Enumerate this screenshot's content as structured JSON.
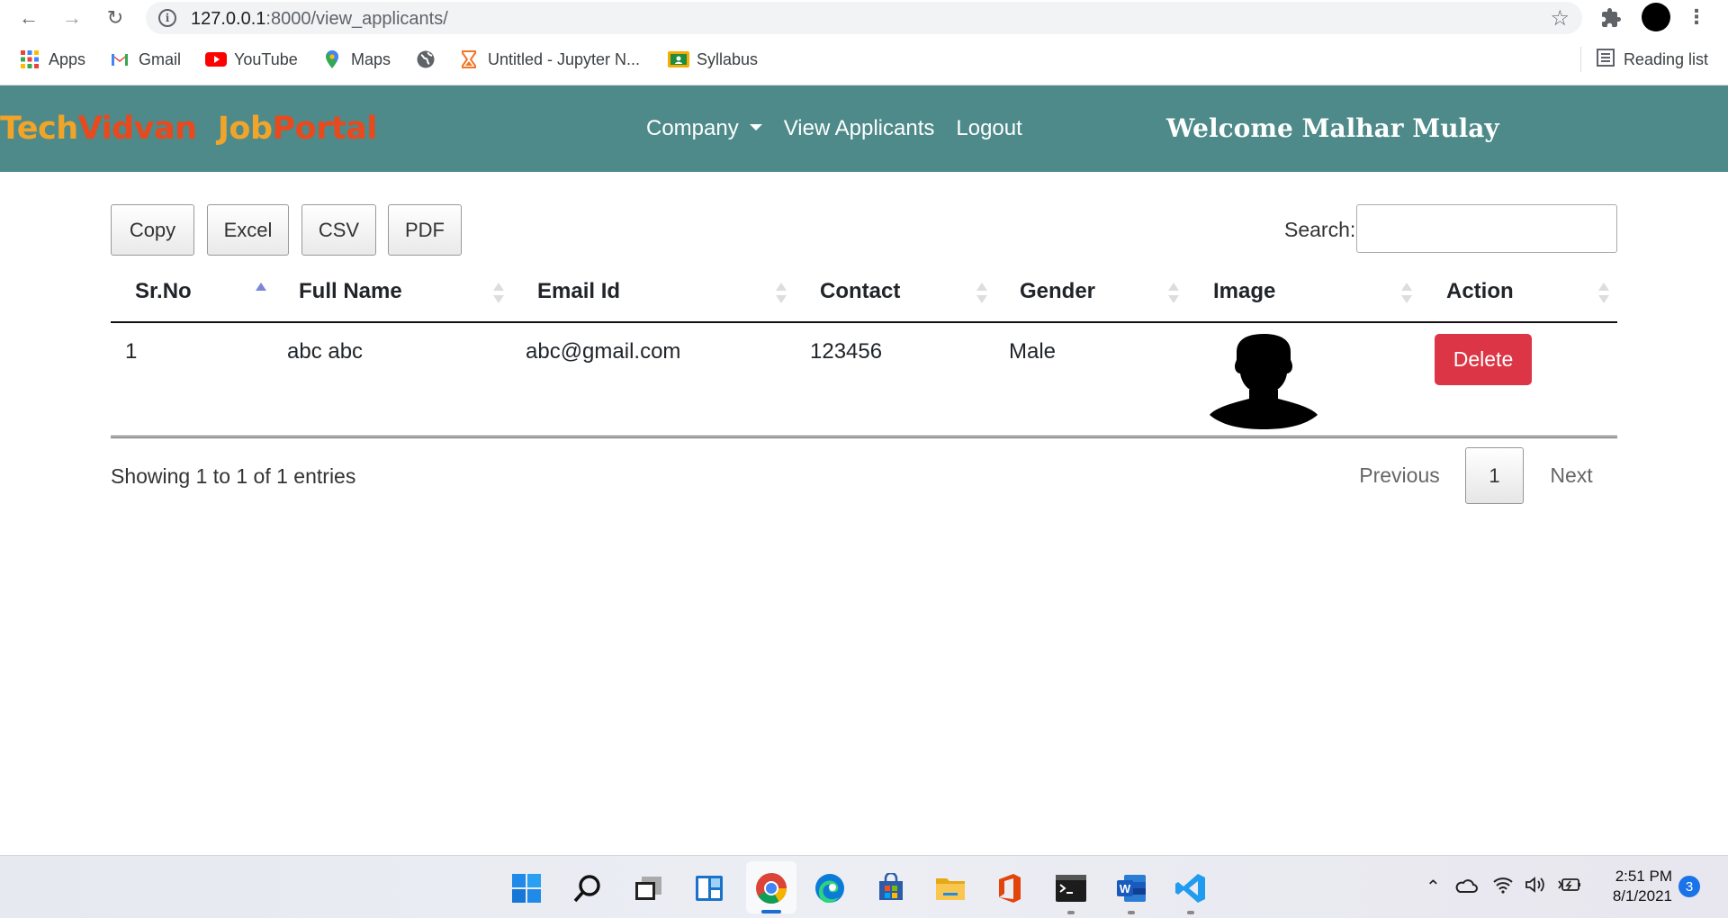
{
  "browser": {
    "url_host": "127.0.0.1",
    "url_path": ":8000/view_applicants/",
    "bookmarks": [
      {
        "label": "Apps",
        "icon": "apps-grid-icon"
      },
      {
        "label": "Gmail",
        "icon": "gmail-icon"
      },
      {
        "label": "YouTube",
        "icon": "youtube-icon"
      },
      {
        "label": "Maps",
        "icon": "maps-icon"
      },
      {
        "label": "",
        "icon": "globe-icon"
      },
      {
        "label": "Untitled - Jupyter N...",
        "icon": "hourglass-icon"
      },
      {
        "label": "Syllabus",
        "icon": "classroom-icon"
      }
    ],
    "reading_list": "Reading list"
  },
  "navbar": {
    "brand_part1": "Tech",
    "brand_part2": "Vidvan",
    "brand_part3": "Job",
    "brand_part4": "Portal",
    "links": [
      "Company",
      "View Applicants",
      "Logout"
    ],
    "welcome": "Welcome Malhar Mulay",
    "bg_color": "#4e8a8a"
  },
  "toolbar": {
    "buttons": [
      "Copy",
      "Excel",
      "CSV",
      "PDF"
    ],
    "search_label": "Search:",
    "search_value": ""
  },
  "table": {
    "columns": [
      "Sr.No",
      "Full Name",
      "Email Id",
      "Contact",
      "Gender",
      "Image",
      "Action"
    ],
    "sorted_column": "Sr.No",
    "rows": [
      {
        "sr_no": "1",
        "full_name": "abc abc",
        "email": "abc@gmail.com",
        "contact": "123456",
        "gender": "Male",
        "image": "person-silhouette-icon",
        "action": "Delete"
      }
    ]
  },
  "footer": {
    "info": "Showing 1 to 1 of 1 entries",
    "previous": "Previous",
    "current_page": "1",
    "next": "Next"
  },
  "taskbar": {
    "time": "2:51 PM",
    "date": "8/1/2021",
    "notifications": "3",
    "apps": [
      "windows-start-icon",
      "search-icon",
      "task-view-icon",
      "widgets-icon",
      "chrome-icon",
      "edge-icon",
      "store-icon",
      "file-explorer-icon",
      "office-icon",
      "terminal-icon",
      "word-icon",
      "vscode-icon"
    ]
  }
}
